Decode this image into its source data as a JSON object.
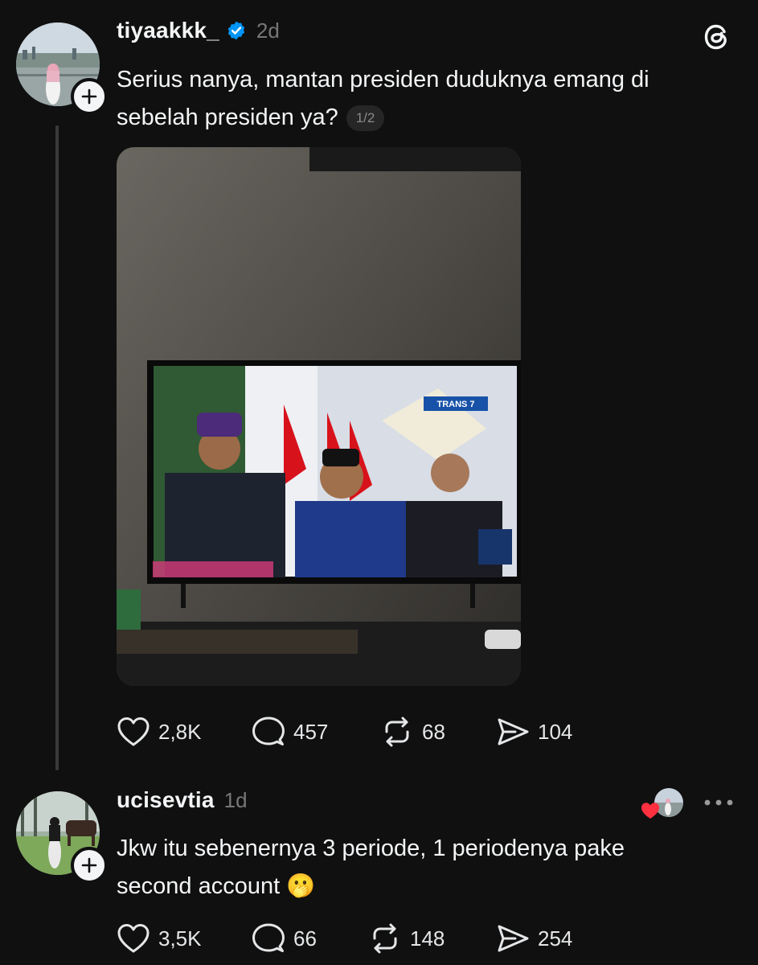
{
  "post": {
    "username": "tiyaakkk_",
    "time": "2d",
    "text_line1": "Serius nanya, mantan presiden duduknya emang di",
    "text_line2": "sebelah presiden ya?",
    "page_indicator": "1/2",
    "image_tv_logo": "TRANS 7",
    "stats": {
      "likes": "2,8K",
      "replies": "457",
      "reposts": "68",
      "shares": "104"
    }
  },
  "reply": {
    "username": "ucisevtia",
    "time": "1d",
    "text_line1": "Jkw itu sebenernya 3 periode, 1 periodenya pake",
    "text_line2": "second account 🫢",
    "stats": {
      "likes": "3,5K",
      "replies": "66",
      "reposts": "148",
      "shares": "254"
    }
  },
  "colors": {
    "background": "#101010",
    "text": "#f3f5f7",
    "verified": "#0095f6",
    "heart": "#ff3040"
  },
  "icons": [
    "threads-logo-icon",
    "verified-badge-icon",
    "heart-icon",
    "comment-icon",
    "repost-icon",
    "share-icon",
    "more-icon",
    "plus-icon"
  ]
}
